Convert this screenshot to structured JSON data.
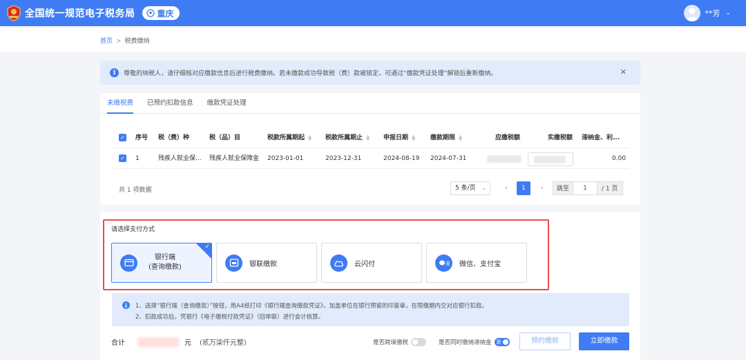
{
  "header": {
    "app_title": "全国统一规范电子税务局",
    "region": "重庆",
    "user_name": "**芳",
    "brand_color": "#3f7cf3"
  },
  "breadcrumb": {
    "home": "首页",
    "current": "税费缴纳"
  },
  "notice": {
    "text": "尊敬的纳税人，请仔细核对应缴款信息后进行税费缴纳。若未缴款成功导致税（费）款被锁定，可通过“缴款凭证处理”解锁后重新缴纳。"
  },
  "tabs": [
    {
      "label": "未缴税费",
      "active": true
    },
    {
      "label": "已预约扣款信息",
      "active": false
    },
    {
      "label": "缴款凭证处理",
      "active": false
    }
  ],
  "table": {
    "columns": [
      "序号",
      "税（费）种",
      "税（品）目",
      "税款所属期起",
      "税款所属期止",
      "申报日期",
      "缴款期限",
      "应缴税额",
      "实缴税额",
      "滞纳金、利..."
    ],
    "rows": [
      {
        "index": "1",
        "tax_type": "残疾人就业保...",
        "tax_item": "残疾人就业保障金",
        "period_start": "2023-01-01",
        "period_end": "2023-12-31",
        "declare_date": "2024-08-19",
        "due_date": "2024-07-31",
        "late_fee": "0.00"
      }
    ],
    "total_text": "共 1 项数据",
    "page_size": "5 条/页",
    "current_page": "1",
    "jump_label": "跳至",
    "jump_value": "1",
    "page_total": "/ 1 页"
  },
  "payment": {
    "title": "请选择支付方式",
    "options": [
      {
        "line1": "银行端",
        "line2": "(查询缴款)",
        "selected": true,
        "icon": "bank-card-icon"
      },
      {
        "label": "银联缴款",
        "selected": false,
        "icon": "unionpay-icon"
      },
      {
        "label": "云闪付",
        "selected": false,
        "icon": "cloud-pay-icon"
      },
      {
        "label": "微信、支付宝",
        "selected": false,
        "icon": "wechat-alipay-icon"
      }
    ],
    "tip_line1": "1、选择“银行端（查询缴款）”按钮，用A4纸打印《银行端查询缴款凭证》，加盖单位在银行预留的印鉴章，在限缴期内交对应银行扣款。",
    "tip_line2": "2、扣款成功后，凭银行《电子缴税付款凭证》（回单联）进行会计核算。"
  },
  "footer": {
    "sum_label": "合计",
    "unit": "元",
    "amount_chinese": "(贰万柒仟元整)",
    "cross_region_label": "是否跨境缴税",
    "late_fee_label": "是否同时缴纳滞纳金",
    "late_fee_switch_text": "是",
    "schedule_btn": "预约缴款",
    "pay_btn": "立即缴款"
  }
}
